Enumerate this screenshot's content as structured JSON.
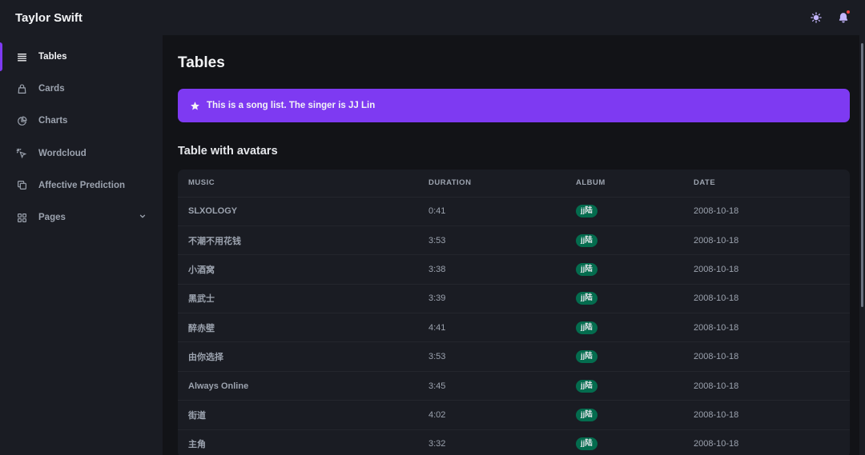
{
  "app": {
    "title": "Taylor Swift"
  },
  "topbar": {
    "theme_icon": "sun-icon",
    "notify_icon": "bell-icon"
  },
  "sidebar": {
    "items": [
      {
        "label": "Tables",
        "icon": "table-icon",
        "active": true
      },
      {
        "label": "Cards",
        "icon": "cards-icon"
      },
      {
        "label": "Charts",
        "icon": "chart-icon"
      },
      {
        "label": "Wordcloud",
        "icon": "cursor-click-icon"
      },
      {
        "label": "Affective Prediction",
        "icon": "copy-icon"
      },
      {
        "label": "Pages",
        "icon": "pages-icon",
        "has_children": true
      }
    ]
  },
  "main": {
    "title": "Tables",
    "banner": {
      "text": "This is a song list. The singer is JJ Lin",
      "icon": "star-icon"
    },
    "section_title": "Table with avatars",
    "table": {
      "headers": [
        "MUSIC",
        "DURATION",
        "ALBUM",
        "DATE"
      ],
      "rows": [
        {
          "music": "SLXOLOGY",
          "duration": "0:41",
          "album": "jj陆",
          "date": "2008-10-18"
        },
        {
          "music": "不潮不用花钱",
          "duration": "3:53",
          "album": "jj陆",
          "date": "2008-10-18"
        },
        {
          "music": "小酒窝",
          "duration": "3:38",
          "album": "jj陆",
          "date": "2008-10-18"
        },
        {
          "music": "黑武士",
          "duration": "3:39",
          "album": "jj陆",
          "date": "2008-10-18"
        },
        {
          "music": "醉赤壁",
          "duration": "4:41",
          "album": "jj陆",
          "date": "2008-10-18"
        },
        {
          "music": "由你选择",
          "duration": "3:53",
          "album": "jj陆",
          "date": "2008-10-18"
        },
        {
          "music": "Always Online",
          "duration": "3:45",
          "album": "jj陆",
          "date": "2008-10-18"
        },
        {
          "music": "街道",
          "duration": "4:02",
          "album": "jj陆",
          "date": "2008-10-18"
        },
        {
          "music": "主角",
          "duration": "3:32",
          "album": "jj陆",
          "date": "2008-10-18"
        }
      ]
    }
  },
  "colors": {
    "accent": "#7e3af2",
    "badge": "#046c4e",
    "background": "#121317",
    "panel": "#1a1c23"
  }
}
